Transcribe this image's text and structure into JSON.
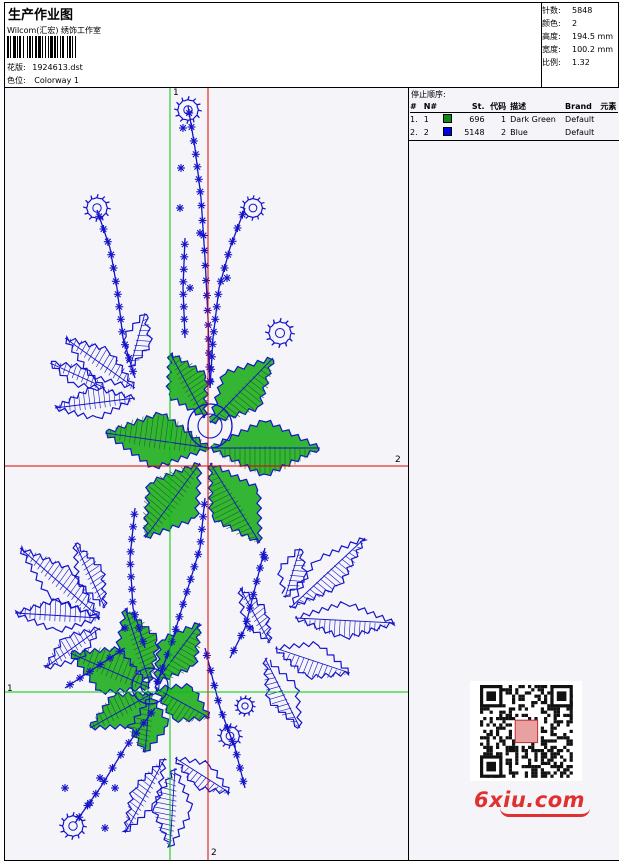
{
  "header": {
    "title": "生产作业图",
    "company": "Wilcom(汇宏) 绣饰工作室",
    "design_label": "花版:",
    "design_file": "1924613.dst",
    "colorway_label": "色位:",
    "colorway": "Colorway 1"
  },
  "stats": [
    {
      "label": "针数:",
      "value": "5848"
    },
    {
      "label": "颜色:",
      "value": "2"
    },
    {
      "label": "高度:",
      "value": "194.5 mm"
    },
    {
      "label": "宽度:",
      "value": "100.2 mm"
    },
    {
      "label": "比例:",
      "value": "1.32"
    }
  ],
  "stop_sequence": {
    "title": "停止顺序:",
    "columns": {
      "index": "#",
      "number": "N#",
      "stitches": "St.",
      "code": "代码",
      "description": "描述",
      "brand": "Brand",
      "element": "元素"
    },
    "rows": [
      {
        "index": "1.",
        "number": "1",
        "color": "#0b8a12",
        "stitches": "696",
        "code": "1",
        "description": "Dark Green",
        "brand": "Default"
      },
      {
        "index": "2.",
        "number": "2",
        "color": "#0000e6",
        "stitches": "5148",
        "code": "2",
        "description": "Blue",
        "brand": "Default"
      }
    ]
  },
  "axes": {
    "h_top_label": "2",
    "h_bottom_label": "1",
    "v_top_label": "1",
    "v_bottom_label": "2"
  },
  "watermark": {
    "text": "6xiu.com",
    "color": "#e03030"
  },
  "colors": {
    "blue_thread": "#1414c8",
    "green_thread": "#34b534",
    "red_axis": "#e00000",
    "green_axis": "#00c800",
    "canvas": "#f5f4f9"
  }
}
